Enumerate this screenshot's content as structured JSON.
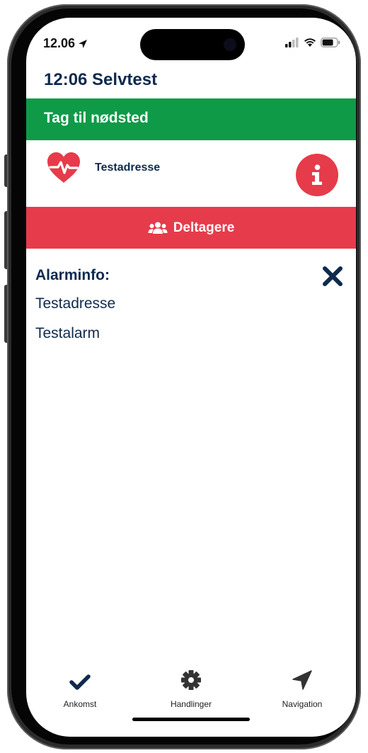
{
  "status": {
    "time": "12.06"
  },
  "header": {
    "title": "12:06 Selvtest"
  },
  "banner": {
    "label": "Tag til nødsted",
    "color": "#0f9a48"
  },
  "address_row": {
    "label": "Testadresse",
    "icon": "heartbeat-icon",
    "info_icon": "info-icon"
  },
  "participants": {
    "label": "Deltagere",
    "icon": "users-icon",
    "color": "#e63b4a"
  },
  "alarm": {
    "title": "Alarminfo:",
    "lines": [
      "Testadresse",
      "Testalarm"
    ]
  },
  "tabs": [
    {
      "label": "Ankomst",
      "icon": "checkmark-icon"
    },
    {
      "label": "Handlinger",
      "icon": "gear-icon"
    },
    {
      "label": "Navigation",
      "icon": "location-arrow-icon"
    }
  ]
}
